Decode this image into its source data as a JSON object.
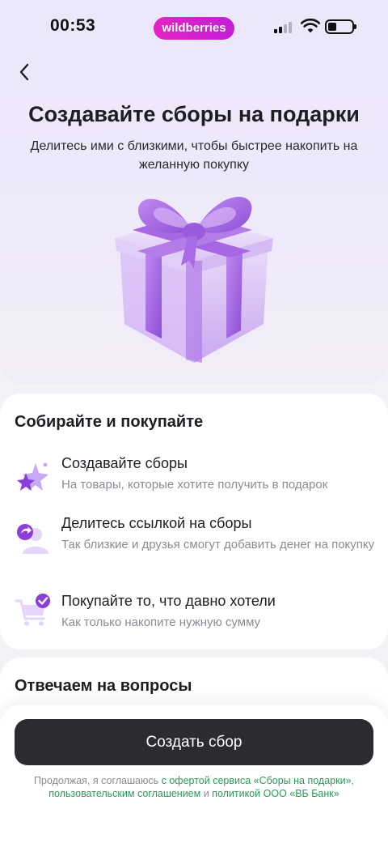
{
  "status_bar": {
    "time": "00:53",
    "brand": "wildberries"
  },
  "header": {
    "back_icon": "chevron-left-icon",
    "title": "Создавайте сборы на подарки",
    "subtitle": "Делитесь ими с близкими, чтобы быстрее накопить на желанную покупку"
  },
  "illustration": {
    "icon": "gift-box-icon",
    "color": "#a66ae0"
  },
  "features": {
    "title": "Собирайте и покупайте",
    "items": [
      {
        "icon": "stars-icon",
        "title": "Создавайте сборы",
        "description": "На товары, которые хотите получить в подарок"
      },
      {
        "icon": "share-user-icon",
        "title": "Делитесь ссылкой на сборы",
        "description": "Так близкие и друзья смогут добавить денег на покупку"
      },
      {
        "icon": "cart-check-icon",
        "title": "Покупайте то, что давно хотели",
        "description": "Как только накопите нужную сумму"
      }
    ]
  },
  "faq": {
    "title": "Отвечаем на вопросы"
  },
  "footer": {
    "button_label": "Создать сбор",
    "legal_prefix": "Продолжая, я соглашаюсь ",
    "legal_link_1": "с офертой сервиса «Сборы на подарки»",
    "legal_sep_1": ", ",
    "legal_link_2": "пользовательским соглашением",
    "legal_sep_2": " и ",
    "legal_link_3": "политикой ООО «ВБ Банк»"
  },
  "colors": {
    "accent": "#a66ae0",
    "brand": "#d921c8",
    "link": "#2a9a5a",
    "button": "#2c2b30"
  }
}
